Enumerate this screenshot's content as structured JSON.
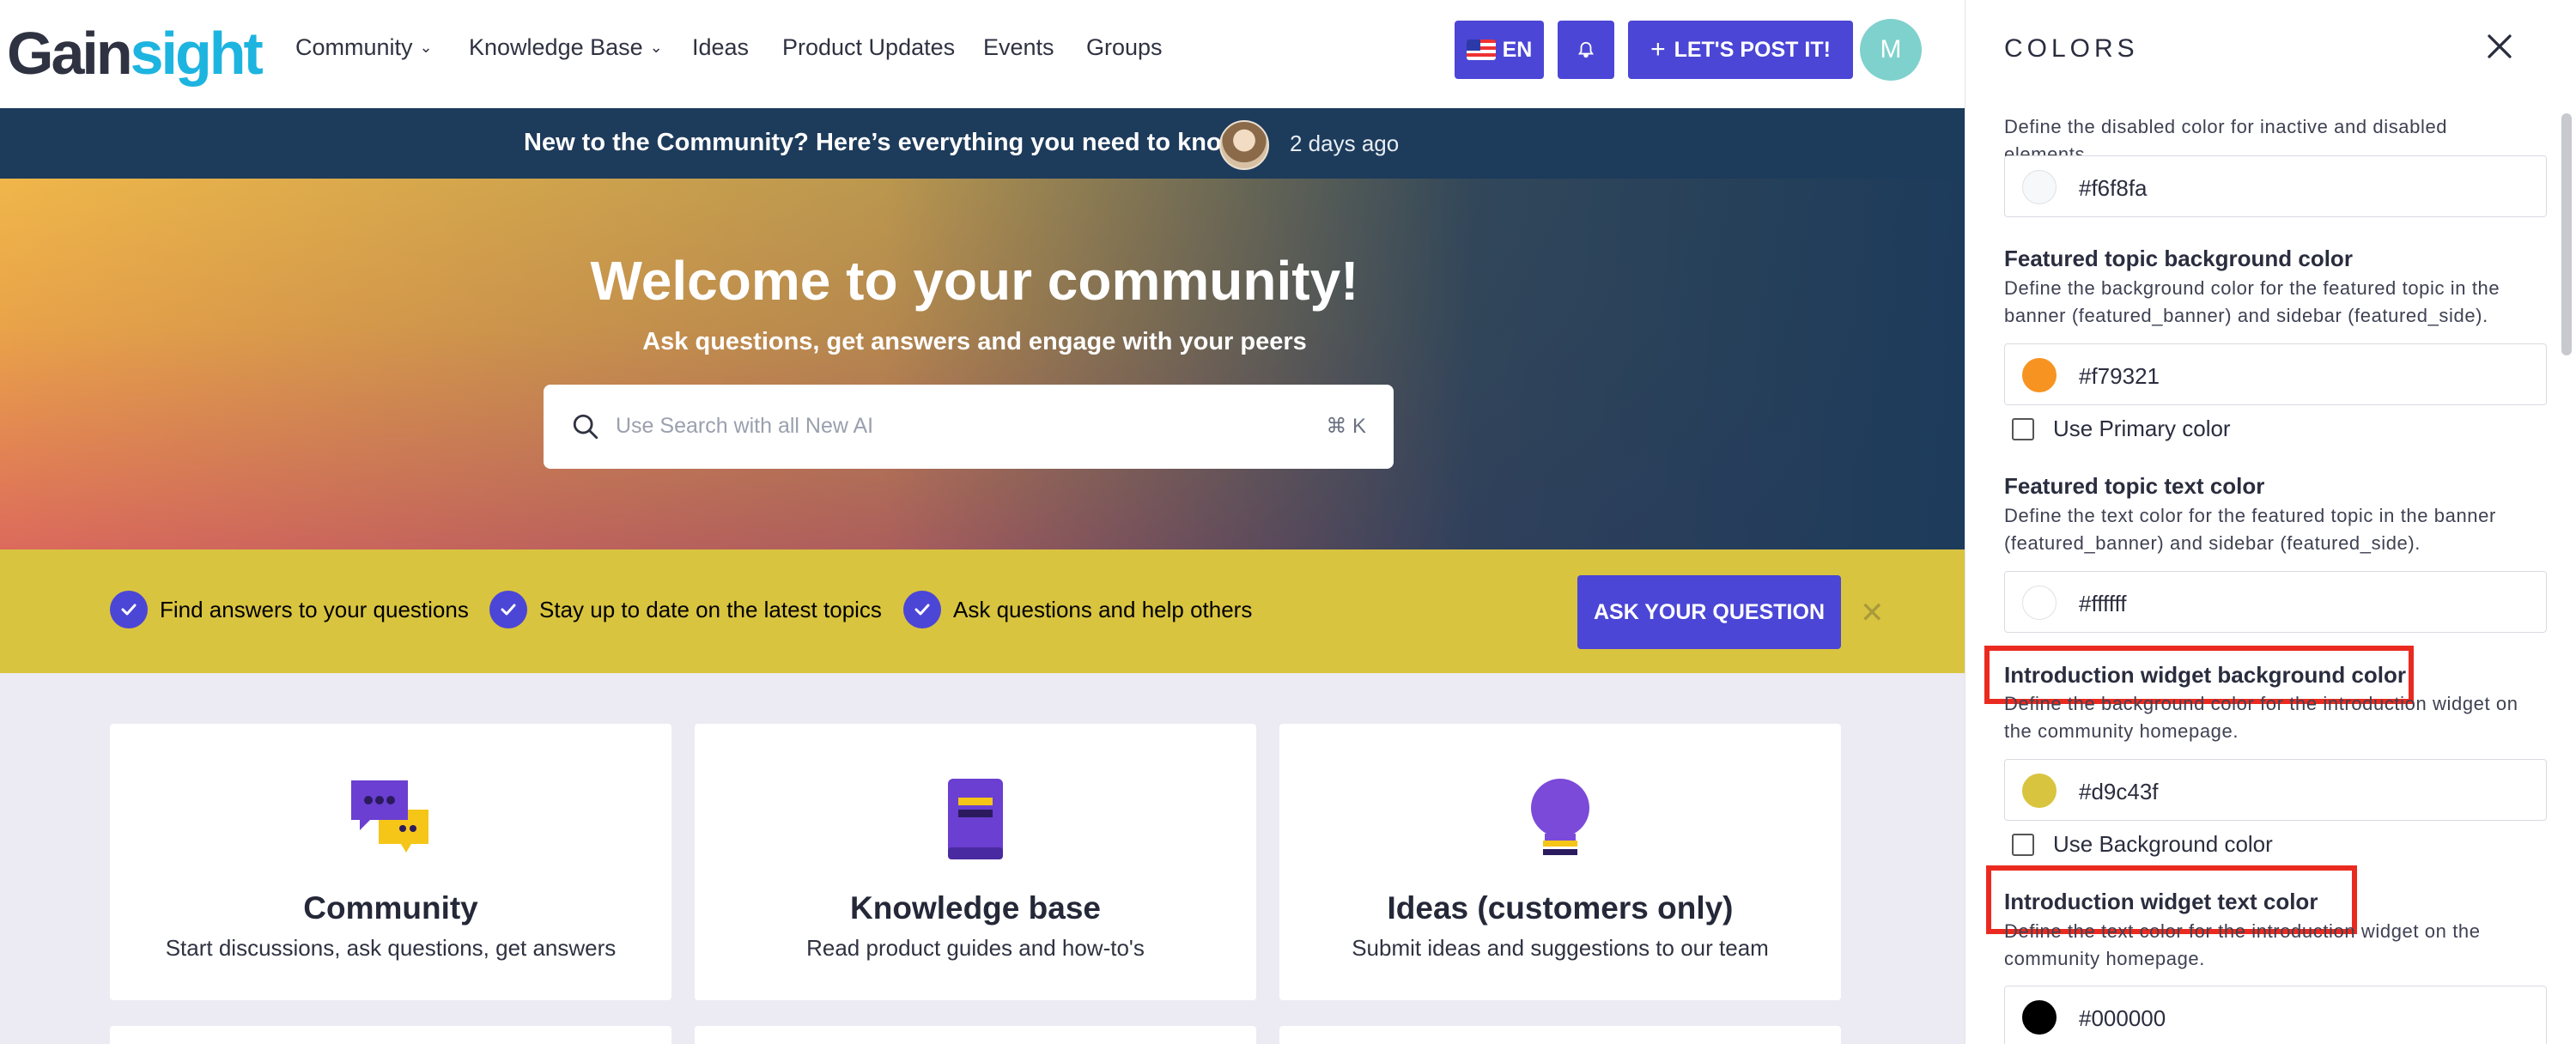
{
  "nav": {
    "logo": {
      "text_main": "Gain",
      "text_accent": "sight"
    },
    "items": [
      {
        "label": "Community",
        "dropdown": true
      },
      {
        "label": "Knowledge Base",
        "dropdown": true
      },
      {
        "label": "Ideas",
        "dropdown": false
      },
      {
        "label": "Product Updates",
        "dropdown": false
      },
      {
        "label": "Events",
        "dropdown": false
      },
      {
        "label": "Groups",
        "dropdown": false
      }
    ],
    "language": "EN",
    "post_button": "LET'S POST IT!",
    "avatar_initial": "M"
  },
  "announcement": {
    "text": "New to the Community? Here’s everything you need to know!",
    "time": "2 days ago"
  },
  "hero": {
    "title": "Welcome to your community!",
    "subtitle": "Ask questions, get answers and engage with your peers",
    "search_placeholder": "Use Search with all New AI",
    "search_shortcut": "⌘ K"
  },
  "intro_widget": {
    "items": [
      "Find answers to your questions",
      "Stay up to date on the latest topics",
      "Ask questions and help others"
    ],
    "button": "ASK YOUR QUESTION",
    "background_color": "#d9c43f"
  },
  "cards": [
    {
      "icon": "chat-bubbles-icon",
      "title": "Community",
      "desc": "Start discussions, ask questions, get answers"
    },
    {
      "icon": "book-icon",
      "title": "Knowledge base",
      "desc": "Read product guides and how-to's"
    },
    {
      "icon": "lightbulb-icon",
      "title": "Ideas (customers only)",
      "desc": "Submit ideas and suggestions to our team"
    }
  ],
  "panel": {
    "title": "COLORS",
    "disabled": {
      "desc": "Define the disabled color for inactive and disabled elements.",
      "value": "#f6f8fa"
    },
    "featured_bg": {
      "label": "Featured topic background color",
      "desc": "Define the background color for the featured topic in the banner (featured_banner) and sidebar (featured_side).",
      "value": "#f79321",
      "checkbox": "Use Primary color"
    },
    "featured_text": {
      "label": "Featured topic text color",
      "desc": "Define the text color for the featured topic in the banner (featured_banner) and sidebar (featured_side).",
      "value": "#ffffff"
    },
    "intro_bg": {
      "label": "Introduction widget background color",
      "desc": "Define the background color for the introduction widget on the community homepage.",
      "value": "#d9c43f",
      "checkbox": "Use Background color"
    },
    "intro_text": {
      "label": "Introduction widget text color",
      "desc": "Define the text color for the introduction widget on the community homepage.",
      "value": "#000000"
    }
  },
  "colors": {
    "accent": "#4b46d6",
    "announcement_bar": "#1d3b5b",
    "highlight": "#ea2a20"
  }
}
